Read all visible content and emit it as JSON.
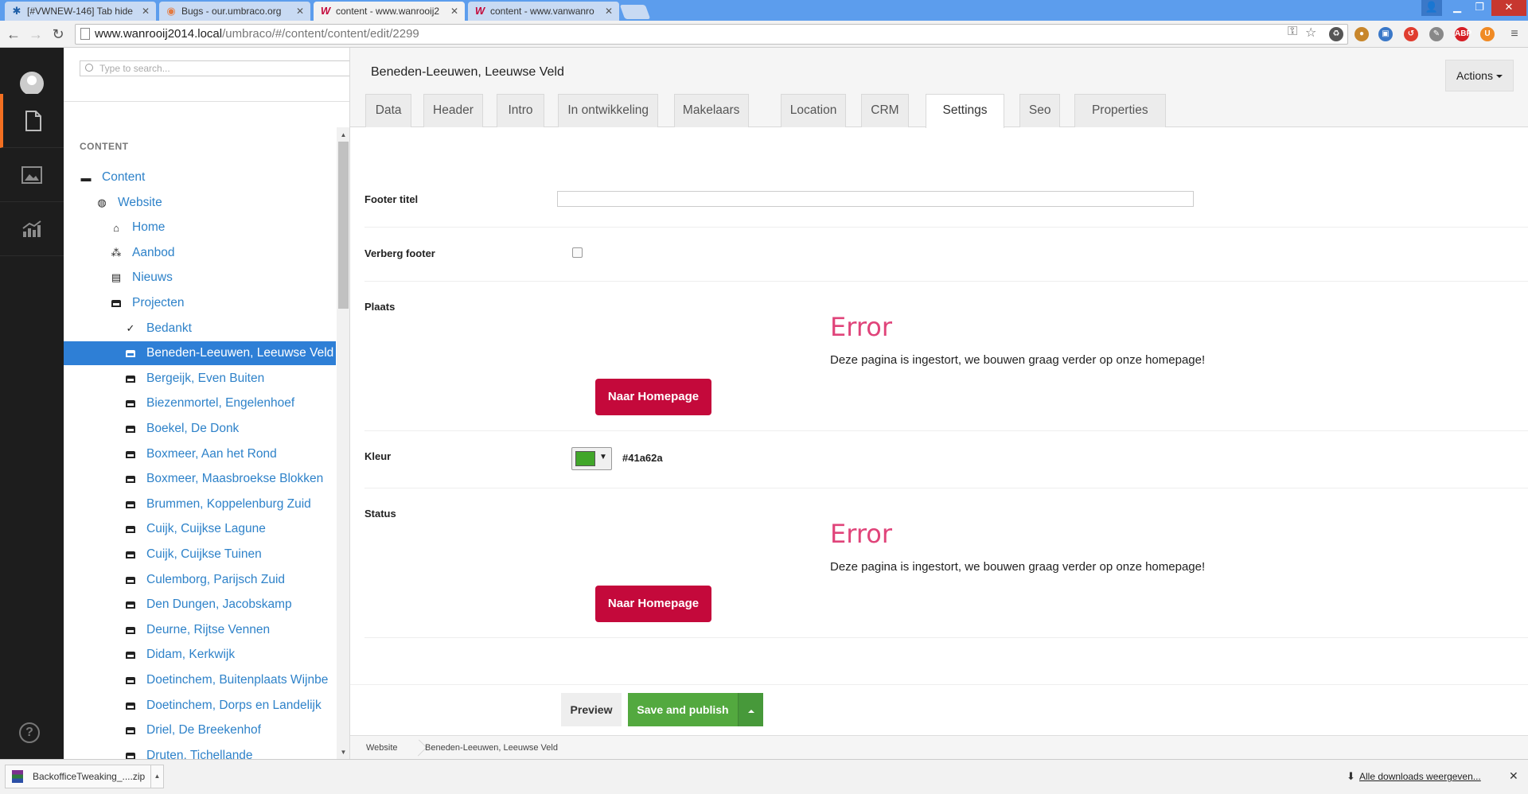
{
  "browser": {
    "tabs": [
      {
        "title": "[#VWNEW-146] Tab hide",
        "icon": "jira-icon"
      },
      {
        "title": "Bugs - our.umbraco.org",
        "icon": "umbraco-icon"
      },
      {
        "title": "content - www.wanrooij2",
        "icon": "w-logo-icon"
      },
      {
        "title": "content - www.vanwanro",
        "icon": "w-logo-icon"
      }
    ],
    "url_host": "www.wanrooij2014.local",
    "url_path": "/umbraco/#/content/content/edit/2299"
  },
  "appbar": {
    "items": [
      "content-icon",
      "media-icon",
      "analytics-icon"
    ],
    "help_label": "?"
  },
  "tree": {
    "search_placeholder": "Type to search...",
    "section_title": "CONTENT",
    "items": [
      {
        "label": "Content",
        "icon": "folder-icon",
        "indent": 0
      },
      {
        "label": "Website",
        "icon": "globe-icon",
        "indent": 1
      },
      {
        "label": "Home",
        "icon": "home-building-icon",
        "indent": 2
      },
      {
        "label": "Aanbod",
        "icon": "sitemap-icon",
        "indent": 2
      },
      {
        "label": "Nieuws",
        "icon": "newspaper-icon",
        "indent": 2
      },
      {
        "label": "Projecten",
        "icon": "project-icon",
        "indent": 2
      },
      {
        "label": "Bedankt",
        "icon": "check-icon",
        "indent": 3
      },
      {
        "label": "Beneden-Leeuwen, Leeuwse Veld",
        "icon": "project-icon",
        "indent": 3,
        "selected": true
      },
      {
        "label": "Bergeijk, Even Buiten",
        "icon": "project-icon",
        "indent": 3
      },
      {
        "label": "Biezenmortel, Engelenhoef",
        "icon": "project-icon",
        "indent": 3
      },
      {
        "label": "Boekel, De Donk",
        "icon": "project-icon",
        "indent": 3
      },
      {
        "label": "Boxmeer, Aan het Rond",
        "icon": "project-icon",
        "indent": 3
      },
      {
        "label": "Boxmeer, Maasbroekse Blokken",
        "icon": "project-icon",
        "indent": 3
      },
      {
        "label": "Brummen, Koppelenburg Zuid",
        "icon": "project-icon",
        "indent": 3
      },
      {
        "label": "Cuijk, Cuijkse Lagune",
        "icon": "project-icon",
        "indent": 3
      },
      {
        "label": "Cuijk, Cuijkse Tuinen",
        "icon": "project-icon",
        "indent": 3
      },
      {
        "label": "Culemborg, Parijsch Zuid",
        "icon": "project-icon",
        "indent": 3
      },
      {
        "label": "Den Dungen, Jacobskamp",
        "icon": "project-icon",
        "indent": 3
      },
      {
        "label": "Deurne, Rijtse Vennen",
        "icon": "project-icon",
        "indent": 3
      },
      {
        "label": "Didam, Kerkwijk",
        "icon": "project-icon",
        "indent": 3
      },
      {
        "label": "Doetinchem, Buitenplaats Wijnbe",
        "icon": "project-icon",
        "indent": 3
      },
      {
        "label": "Doetinchem, Dorps en Landelijk",
        "icon": "project-icon",
        "indent": 3
      },
      {
        "label": "Driel, De Breekenhof",
        "icon": "project-icon",
        "indent": 3
      },
      {
        "label": "Druten, Tichellande",
        "icon": "project-icon",
        "indent": 3
      }
    ]
  },
  "editor": {
    "document_name": "Beneden-Leeuwen, Leeuwse Veld",
    "actions_label": "Actions",
    "tabs": [
      "Data",
      "Header",
      "Intro",
      "In ontwikkeling",
      "Makelaars",
      "Location",
      "CRM",
      "Settings",
      "Seo",
      "Properties"
    ],
    "active_tab": "Settings",
    "properties": {
      "footer_titel_label": "Footer titel",
      "footer_titel_value": "",
      "verberg_footer_label": "Verberg footer",
      "verberg_footer_checked": false,
      "plaats_label": "Plaats",
      "kleur_label": "Kleur",
      "kleur_value": "#41a62a",
      "status_label": "Status"
    },
    "error_block": {
      "title": "Error",
      "message": "Deze pagina is ingestort, we bouwen graag verder op onze homepage!",
      "button_label": "Naar Homepage"
    },
    "preview_label": "Preview",
    "save_label": "Save and publish",
    "breadcrumb": [
      "Website",
      "Beneden-Leeuwen, Leeuwse Veld"
    ]
  },
  "download_shelf": {
    "file_name": "BackofficeTweaking_....zip",
    "all_downloads_label": "Alle downloads weergeven..."
  },
  "colors": {
    "accent_orange": "#f36f21",
    "selected_blue": "#2e7fd6",
    "error_pink": "#e0447a",
    "homepage_red": "#c4093b",
    "save_green": "#53a93f"
  }
}
